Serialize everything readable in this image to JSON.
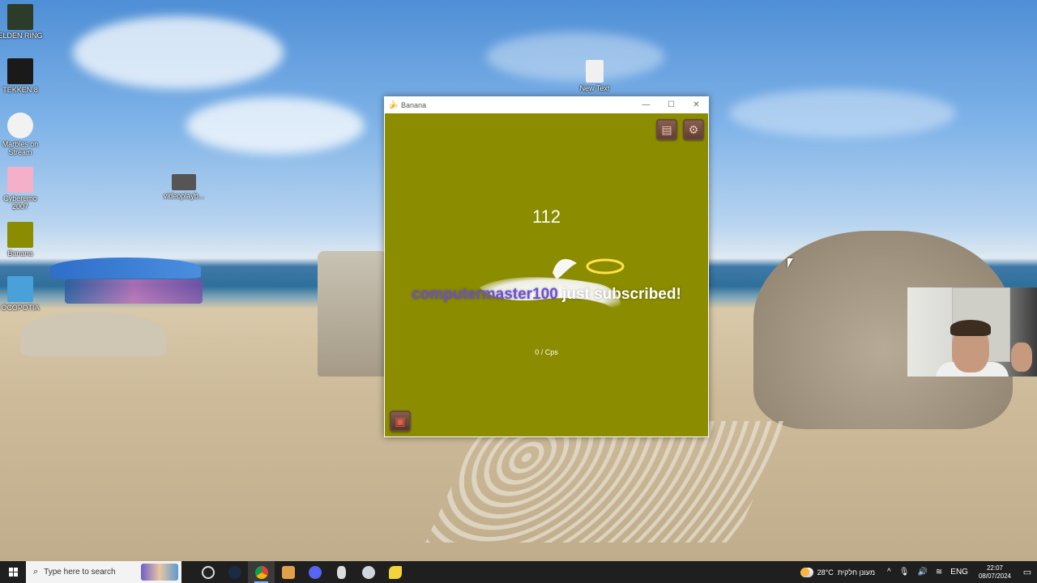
{
  "desktop": {
    "icons": [
      {
        "label": "ELDEN RING",
        "color": "#2c3b2a"
      },
      {
        "label": "TEKKEN 8",
        "color": "#1a1a1a"
      },
      {
        "label": "Marbles on Stream",
        "color": "#f2f2f2"
      },
      {
        "label": "Cyberemo 2007",
        "color": "#f4b0c8"
      },
      {
        "label": "Banana",
        "color": "#8b8c00"
      },
      {
        "label": "ОСОРОТІА",
        "color": "#4aa0d8"
      },
      {
        "label": "videoplayb...",
        "color": "#555555"
      },
      {
        "label": "New Text",
        "color": "#f0f0f0"
      }
    ]
  },
  "window": {
    "title": "Banana",
    "app_icon": "banana-icon",
    "controls": {
      "minimize": "—",
      "maximize": "☐",
      "close": "✕"
    }
  },
  "game": {
    "background": "#8b8c00",
    "banana_count": "112",
    "subscriber_name": "computermaster100",
    "subscriber_suffix": " just subscribed!",
    "cps_text": "0 / Cps",
    "buttons": {
      "shop": "shop-icon",
      "settings": "settings-icon",
      "upgrades": "upgrades-icon"
    }
  },
  "taskbar": {
    "search_placeholder": "Type here to search",
    "weather_temp": "28°C",
    "weather_text": "מעונן חלקית",
    "language": "ENG",
    "time": "22:07",
    "date": "08/07/2024"
  }
}
